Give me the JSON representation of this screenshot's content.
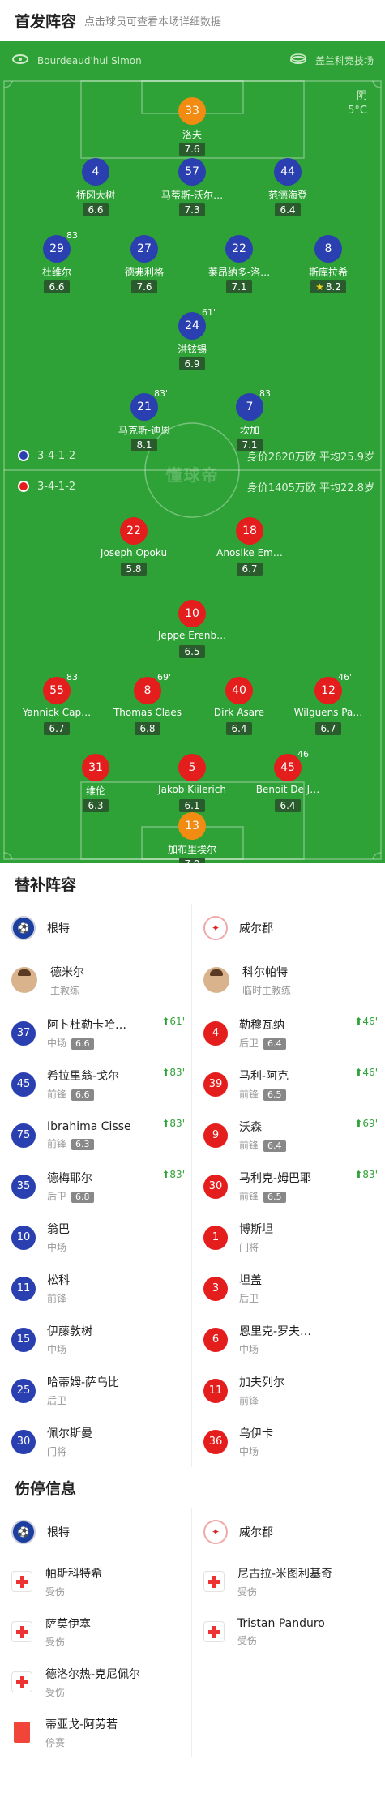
{
  "lineup": {
    "title": "首发阵容",
    "subtitle": "点击球员可查看本场详细数据",
    "referee": "Bourdeaud'hui Simon",
    "stadium": "盖兰科竞技场",
    "weather": "阴",
    "temperature": "5°C",
    "watermark": "懂球帝",
    "home_formation": "3-4-1-2",
    "home_value": "身价2620万欧 平均25.9岁",
    "away_formation": "3-4-1-2",
    "away_value": "身价1405万欧 平均22.8岁",
    "players": [
      {
        "num": "33",
        "name": "洛夫",
        "rating": "7.6",
        "team": "orange",
        "captain": true
      },
      {
        "num": "4",
        "name": "桥冈大树",
        "rating": "6.6",
        "team": "blue"
      },
      {
        "num": "57",
        "name": "马蒂斯-沃尔…",
        "rating": "7.3",
        "team": "blue"
      },
      {
        "num": "44",
        "name": "范德海登",
        "rating": "6.4",
        "team": "blue",
        "yellow": true
      },
      {
        "num": "29",
        "name": "杜维尔",
        "rating": "6.6",
        "team": "blue",
        "sub": "83'"
      },
      {
        "num": "27",
        "name": "德弗利格",
        "rating": "7.6",
        "team": "blue",
        "yellow": true
      },
      {
        "num": "22",
        "name": "莱昂纳多-洛…",
        "rating": "7.1",
        "team": "blue"
      },
      {
        "num": "8",
        "name": "斯库拉希",
        "rating": "8.2",
        "team": "blue",
        "best": true
      },
      {
        "num": "24",
        "name": "洪铉锡",
        "rating": "6.9",
        "team": "blue",
        "sub": "61'"
      },
      {
        "num": "21",
        "name": "马克斯-迪恩",
        "rating": "8.1",
        "team": "blue",
        "sub": "83'",
        "goal": true
      },
      {
        "num": "7",
        "name": "坎加",
        "rating": "7.1",
        "team": "blue",
        "sub": "83'",
        "goal": true
      },
      {
        "num": "22",
        "name": "Joseph Opoku",
        "rating": "5.8",
        "team": "red"
      },
      {
        "num": "18",
        "name": "Anosike Em…",
        "rating": "6.7",
        "team": "red"
      },
      {
        "num": "10",
        "name": "Jeppe Erenb…",
        "rating": "6.5",
        "team": "red",
        "captain": true
      },
      {
        "num": "55",
        "name": "Yannick Cap…",
        "rating": "6.7",
        "team": "red",
        "sub": "83'"
      },
      {
        "num": "8",
        "name": "Thomas Claes",
        "rating": "6.8",
        "team": "red",
        "sub": "69'"
      },
      {
        "num": "40",
        "name": "Dirk Asare",
        "rating": "6.4",
        "team": "red",
        "yellow": true
      },
      {
        "num": "12",
        "name": "Wilguens Pa…",
        "rating": "6.7",
        "team": "red",
        "sub": "46'"
      },
      {
        "num": "31",
        "name": "维伦",
        "rating": "6.3",
        "team": "red"
      },
      {
        "num": "5",
        "name": "Jakob Kiilerich",
        "rating": "6.1",
        "team": "red"
      },
      {
        "num": "45",
        "name": "Benoit De J…",
        "rating": "6.4",
        "team": "red",
        "sub": "46'"
      },
      {
        "num": "13",
        "name": "加布里埃尔",
        "rating": "7.0",
        "team": "orange"
      }
    ]
  },
  "substitutes": {
    "title": "替补阵容",
    "home_team": "根特",
    "away_team": "威尔郡",
    "home_coach": {
      "name": "德米尔",
      "role": "主教练"
    },
    "away_coach": {
      "name": "科尔帕特",
      "role": "临时主教练"
    },
    "home": [
      {
        "num": "37",
        "name": "阿卜杜勒卡哈…",
        "pos": "中场",
        "rating": "6.6",
        "min": "61'"
      },
      {
        "num": "45",
        "name": "希拉里翁-戈尔",
        "pos": "前锋",
        "rating": "6.6",
        "min": "83'"
      },
      {
        "num": "75",
        "name": "Ibrahima Cisse",
        "pos": "前锋",
        "rating": "6.3",
        "min": "83'"
      },
      {
        "num": "35",
        "name": "德梅耶尔",
        "pos": "后卫",
        "rating": "6.8",
        "min": "83'"
      },
      {
        "num": "10",
        "name": "翁巴",
        "pos": "中场"
      },
      {
        "num": "11",
        "name": "松科",
        "pos": "前锋"
      },
      {
        "num": "15",
        "name": "伊藤敦树",
        "pos": "中场"
      },
      {
        "num": "25",
        "name": "哈蒂姆-萨乌比",
        "pos": "后卫"
      },
      {
        "num": "30",
        "name": "佩尔斯曼",
        "pos": "门将"
      }
    ],
    "away": [
      {
        "num": "4",
        "name": "勒穆瓦纳",
        "pos": "后卫",
        "rating": "6.4",
        "min": "46'"
      },
      {
        "num": "39",
        "name": "马利-阿克",
        "pos": "前锋",
        "rating": "6.5",
        "min": "46'"
      },
      {
        "num": "9",
        "name": "沃森",
        "pos": "前锋",
        "rating": "6.4",
        "min": "69'"
      },
      {
        "num": "30",
        "name": "马利克-姆巴耶",
        "pos": "前锋",
        "rating": "6.5",
        "min": "83'"
      },
      {
        "num": "1",
        "name": "博斯坦",
        "pos": "门将"
      },
      {
        "num": "3",
        "name": "坦盖",
        "pos": "后卫"
      },
      {
        "num": "6",
        "name": "恩里克-罗夫…",
        "pos": "中场"
      },
      {
        "num": "11",
        "name": "加夫列尔",
        "pos": "前锋"
      },
      {
        "num": "36",
        "name": "乌伊卡",
        "pos": "中场"
      }
    ]
  },
  "injuries": {
    "title": "伤停信息",
    "home_team": "根特",
    "away_team": "威尔郡",
    "home": [
      {
        "name": "帕斯科特希",
        "status": "受伤",
        "type": "injury"
      },
      {
        "name": "萨莫伊塞",
        "status": "受伤",
        "type": "injury"
      },
      {
        "name": "德洛尔热-克尼佩尔",
        "status": "受伤",
        "type": "injury"
      },
      {
        "name": "蒂亚戈-阿劳若",
        "status": "停赛",
        "type": "suspension"
      }
    ],
    "away": [
      {
        "name": "尼古拉-米图利基奇",
        "status": "受伤",
        "type": "injury"
      },
      {
        "name": "Tristan Panduro",
        "status": "受伤",
        "type": "injury"
      }
    ]
  }
}
